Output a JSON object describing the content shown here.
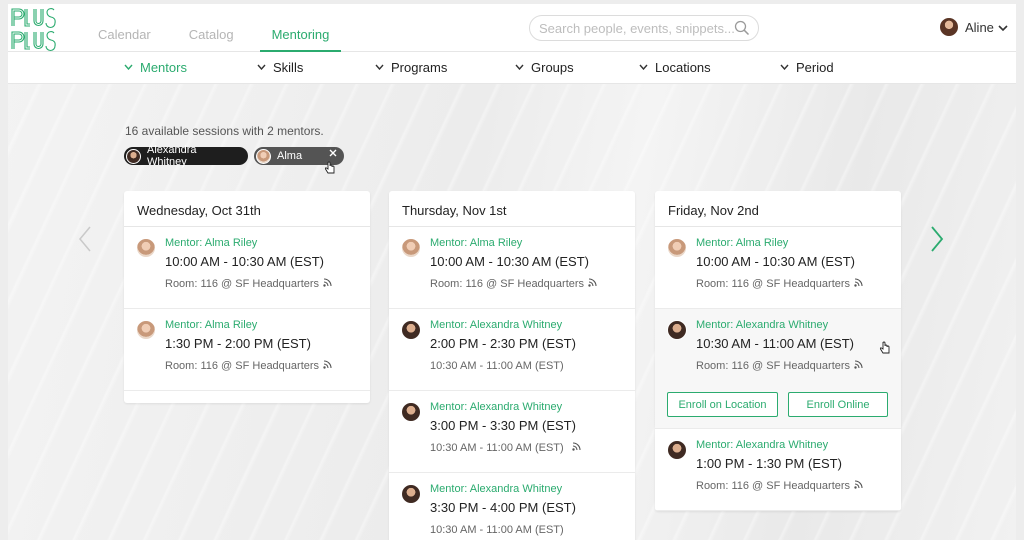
{
  "header": {
    "logo_text": "Plus Plus",
    "tabs": [
      {
        "label": "Calendar"
      },
      {
        "label": "Catalog"
      },
      {
        "label": "Mentoring"
      }
    ],
    "search_placeholder": "Search people, events, snippets...",
    "user_name": "Aline"
  },
  "filters": {
    "items": [
      {
        "label": "Mentors"
      },
      {
        "label": "Skills"
      },
      {
        "label": "Programs"
      },
      {
        "label": "Groups"
      },
      {
        "label": "Locations"
      },
      {
        "label": "Period"
      }
    ]
  },
  "summary": "16 available sessions with 2 mentors.",
  "chips": [
    {
      "label": "Alexandra Whitney"
    },
    {
      "label": "Alma"
    }
  ],
  "days": [
    {
      "title": "Wednesday, Oct 31th",
      "sessions": [
        {
          "mentor": "Mentor: Alma Riley",
          "time": "10:00 AM - 10:30 AM (EST)",
          "room": "Room: 116 @ SF Headquarters"
        },
        {
          "mentor": "Mentor: Alma Riley",
          "time": "1:30 PM - 2:00 PM (EST)",
          "room": "Room: 116 @ SF Headquarters"
        }
      ]
    },
    {
      "title": "Thursday, Nov 1st",
      "sessions": [
        {
          "mentor": "Mentor: Alma Riley",
          "time": "10:00 AM - 10:30 AM (EST)",
          "room": "Room: 116 @ SF Headquarters"
        },
        {
          "mentor": "Mentor: Alexandra Whitney",
          "time": "2:00 PM - 2:30 PM (EST)",
          "room": "10:30 AM - 11:00 AM (EST)"
        },
        {
          "mentor": "Mentor: Alexandra Whitney",
          "time": "3:00 PM - 3:30 PM (EST)",
          "room": "10:30 AM - 11:00 AM (EST)"
        },
        {
          "mentor": "Mentor: Alexandra Whitney",
          "time": "3:30 PM - 4:00 PM (EST)",
          "room": "10:30 AM - 11:00 AM (EST)"
        }
      ]
    },
    {
      "title": "Friday, Nov 2nd",
      "sessions": [
        {
          "mentor": "Mentor: Alma Riley",
          "time": "10:00 AM - 10:30 AM (EST)",
          "room": "Room: 116 @ SF Headquarters"
        },
        {
          "mentor": "Mentor: Alexandra Whitney",
          "time": "10:30 AM - 11:00 AM (EST)",
          "room": "Room: 116 @ SF Headquarters"
        },
        {
          "mentor": "Mentor: Alexandra Whitney",
          "time": "1:00 PM - 1:30 PM (EST)",
          "room": "Room: 116 @ SF Headquarters"
        }
      ]
    }
  ],
  "actions": {
    "enroll_location": "Enroll on Location",
    "enroll_online": "Enroll Online"
  },
  "colors": {
    "accent": "#2bab6f",
    "chip_dark": "#1e1e1e",
    "chip_gray": "#545454"
  },
  "icons": [
    "search-icon",
    "chevron-down-icon",
    "close-icon",
    "rss-icon",
    "arrow-left-icon",
    "arrow-right-icon",
    "cursor-icon"
  ]
}
